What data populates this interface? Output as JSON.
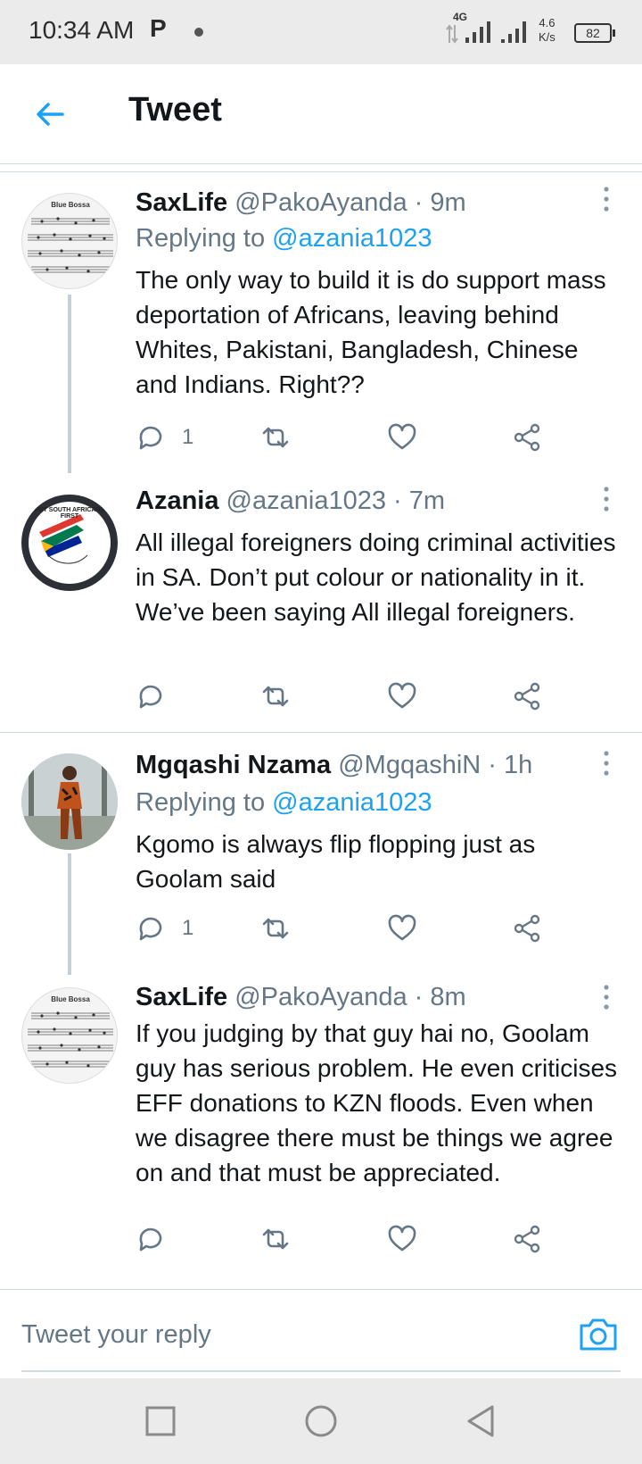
{
  "status_bar": {
    "time": "10:34 AM",
    "app_badge": "P",
    "network": "4G",
    "speed": "4.6",
    "speed_unit": "K/s",
    "battery": "82"
  },
  "header": {
    "title": "Tweet",
    "back_icon": "arrow-left-icon"
  },
  "tweets": [
    {
      "name": "SaxLife",
      "handle": "@PakoAyanda",
      "time": "· 9m",
      "replying_label": "Replying to",
      "replying_mention": "@azania1023",
      "body": "The only way to build it is do support mass deportation of Africans, leaving behind Whites, Pakistani, Bangladesh, Chinese and Indians. Right??",
      "reply_count": "1",
      "avatar_text": "Blue Bossa"
    },
    {
      "name": "Azania",
      "handle": "@azania1023",
      "time": "· 7m",
      "body": "All illegal foreigners doing criminal activities in SA. Don’t put colour or nationality in it. We’ve been saying All illegal foreigners.",
      "reply_count": "",
      "avatar_text": "PUT SOUTH AFRICANS FIRST"
    },
    {
      "name": "Mgqashi Nzama",
      "handle": "@MgqashiN",
      "time": "· 1h",
      "replying_label": "Replying to",
      "replying_mention": "@azania1023",
      "body": "Kgomo is always flip flopping just as Goolam said",
      "reply_count": "1"
    },
    {
      "name": "SaxLife",
      "handle": "@PakoAyanda",
      "time": "· 8m",
      "body": "If you judging by that guy hai no, Goolam guy has serious problem. He even criticises EFF donations to KZN floods. Even when we disagree there must be things we agree on and that must be appreciated.",
      "reply_count": "",
      "avatar_text": "Blue Bossa"
    }
  ],
  "reply_bar": {
    "placeholder": "Tweet your reply",
    "camera_icon": "camera-icon"
  },
  "colors": {
    "accent": "#1da1f2",
    "text": "#14171a",
    "secondary": "#657786",
    "divider": "#cfd9de"
  }
}
